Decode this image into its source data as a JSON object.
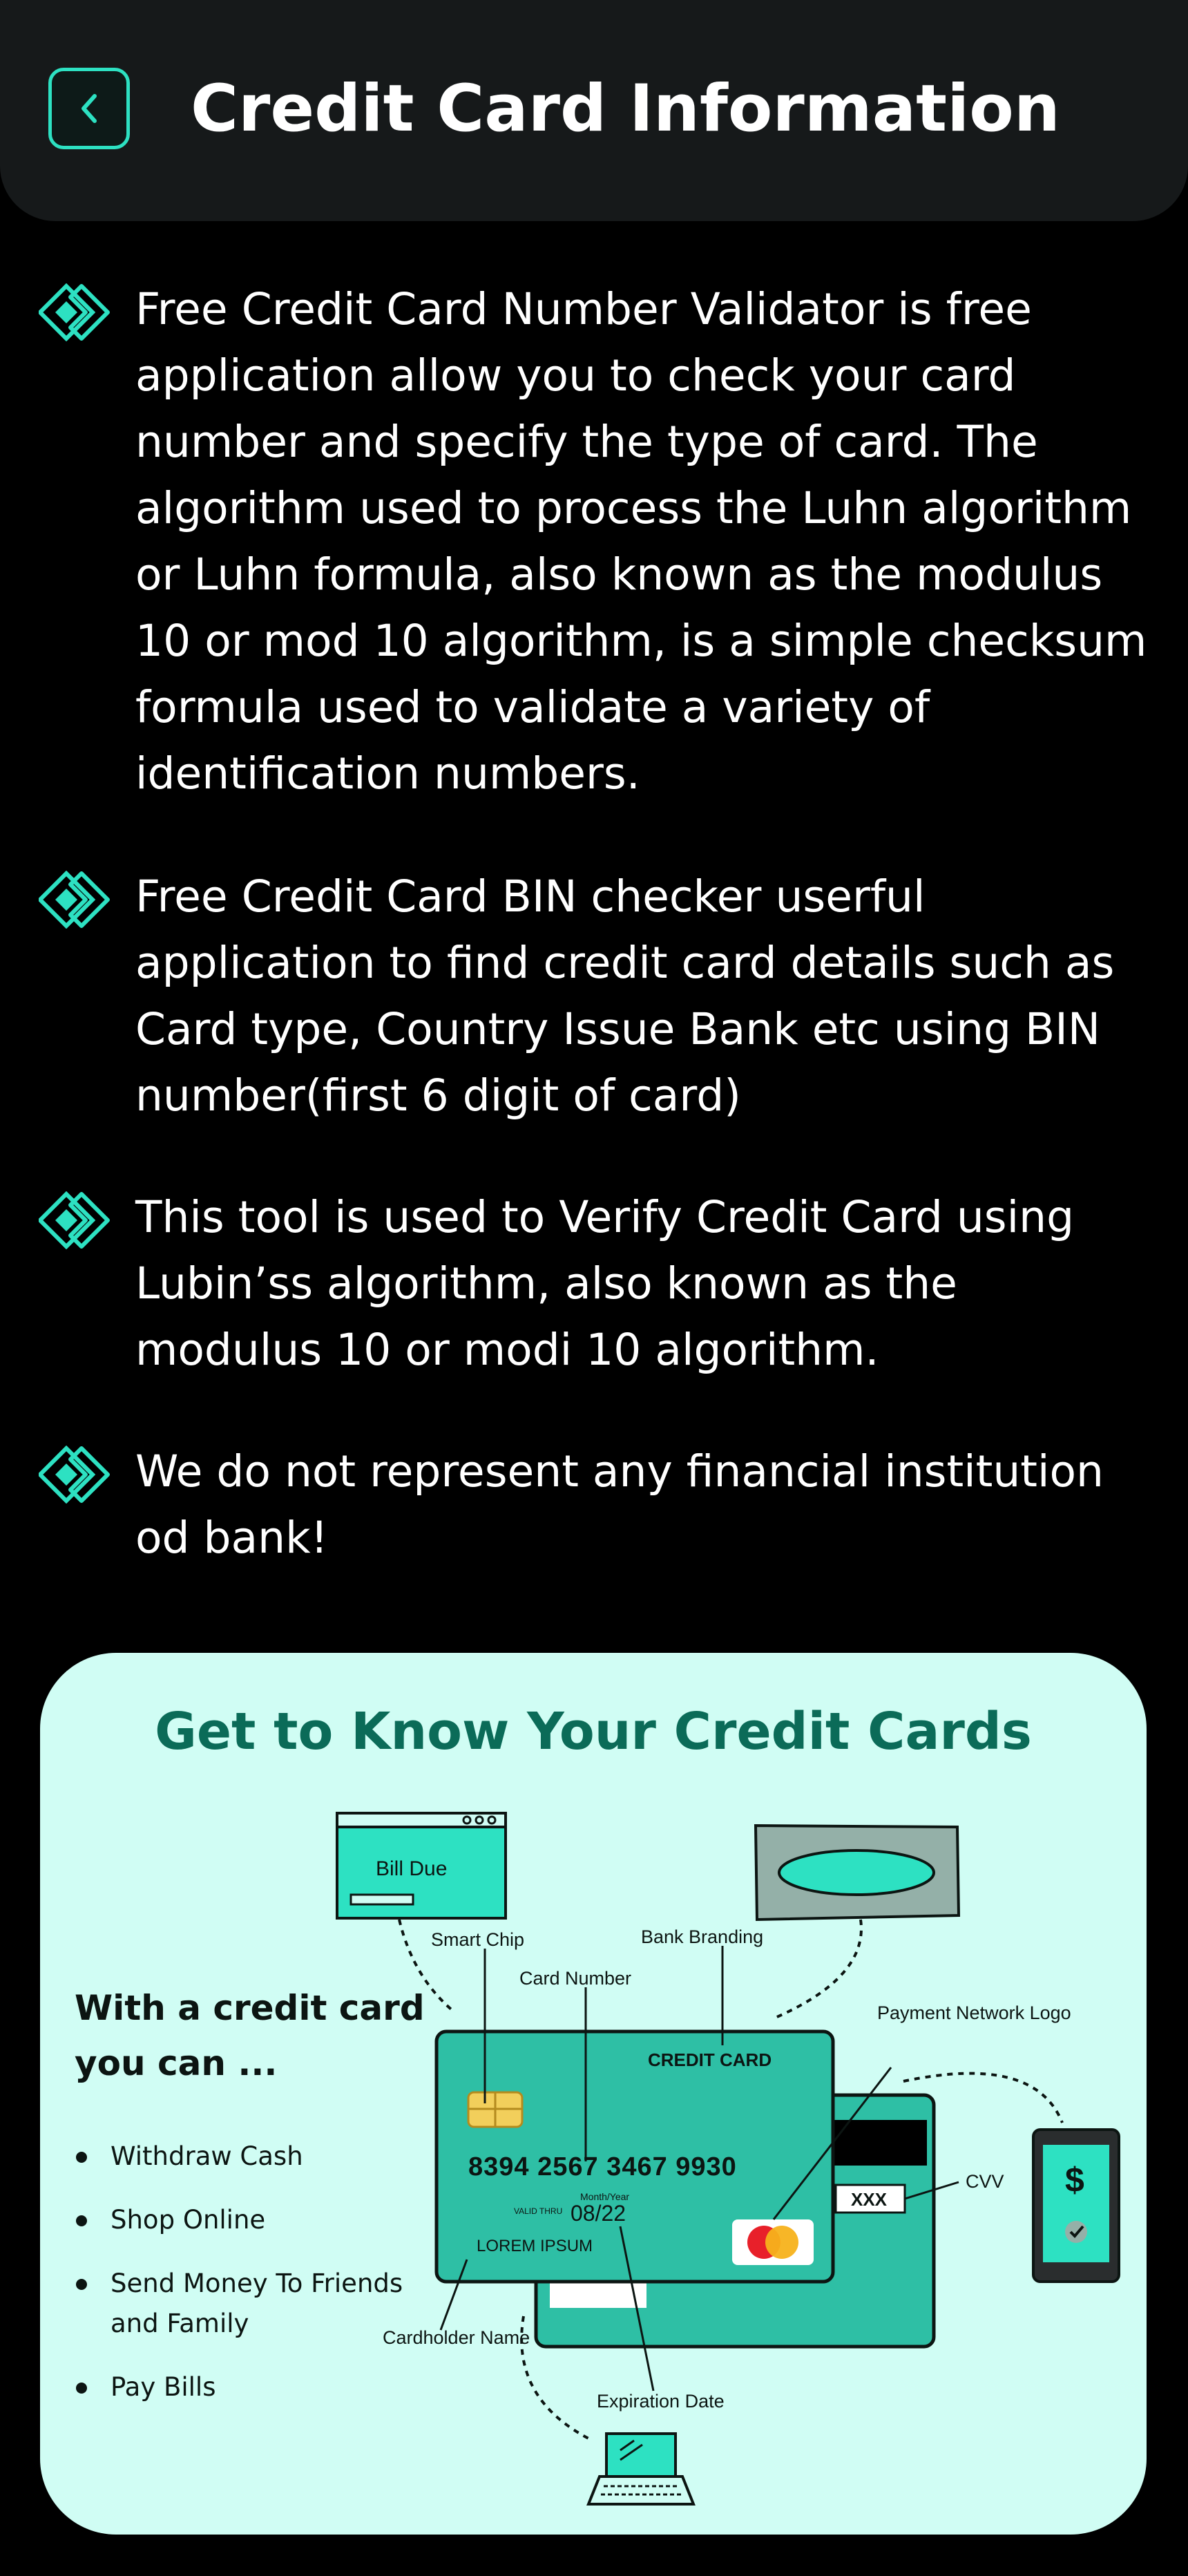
{
  "header": {
    "title": "Credit Card Information",
    "back_icon": "chevron-left-icon"
  },
  "bullets": [
    {
      "icon": "diamond-icon",
      "text": "Free Credit Card Number Validator is free application allow you to check your card number and specify the type of card. The algorithm used to process the Luhn algorithm or Luhn formula, also known as the modulus 10 or mod 10 algorithm, is a simple checksum formula used to validate a variety of identification numbers."
    },
    {
      "icon": "diamond-icon",
      "text": "Free Credit Card BIN checker userful application to find credit card details such as Card type, Country Issue Bank etc using BIN number(first 6 digit of card)"
    },
    {
      "icon": "diamond-icon",
      "text": "This tool is used to Verify Credit Card using Lubin’ss algorithm, also known as the modulus 10 or modi 10 algorithm."
    },
    {
      "icon": "diamond-icon",
      "text": "We do not represent any financial institution od bank!"
    }
  ],
  "panel": {
    "title": "Get to Know Your Credit Cards",
    "subtitle": "With a credit card you can ...",
    "uses": [
      "Withdraw Cash",
      "Shop Online",
      "Send Money To Friends and Family",
      "Pay Bills"
    ],
    "diagram": {
      "bill_due": "Bill Due",
      "smart_chip": "Smart Chip",
      "card_number_label": "Card Number",
      "bank_branding": "Bank Branding",
      "payment_network_logo": "Payment Network Logo",
      "card_brand": "CREDIT CARD",
      "card_number": "8394 2567 3467 9930",
      "valid_thru": "VALID THRU",
      "month_year": "Month/Year",
      "expiry": "08/22",
      "holder": "LOREM IPSUM",
      "cvv_value": "XXX",
      "cvv_label": "CVV",
      "cardholder_name": "Cardholder Name",
      "expiration_date": "Expiration Date",
      "dollar": "$"
    }
  },
  "colors": {
    "background": "#000000",
    "header": "#16191a",
    "accent": "#2de1c2",
    "panel": "#d0fdf4",
    "panel_title": "#0b6b58",
    "card": "#2ebfa5"
  }
}
